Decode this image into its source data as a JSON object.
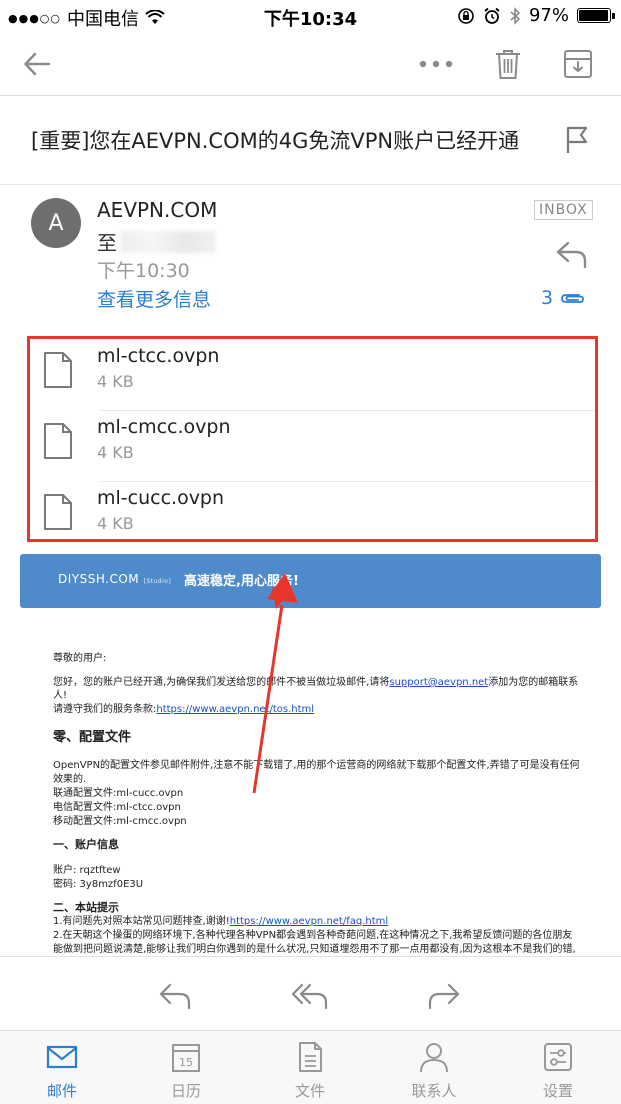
{
  "status_bar": {
    "carrier": "中国电信",
    "time": "下午10:34",
    "battery": "97%",
    "battery_level": 0.97
  },
  "email": {
    "subject": "[重要]您在AEVPN.COM的4G免流VPN账户已经开通",
    "avatar_letter": "A",
    "sender": "AEVPN.COM",
    "to_label": "至",
    "time": "下午10:30",
    "more_info": "查看更多信息",
    "folder_badge": "INBOX",
    "attachment_count": "3"
  },
  "attachments": [
    {
      "name": "ml-ctcc.ovpn",
      "size": "4 KB"
    },
    {
      "name": "ml-cmcc.ovpn",
      "size": "4 KB"
    },
    {
      "name": "ml-cucc.ovpn",
      "size": "4 KB"
    }
  ],
  "content": {
    "banner_logo": "DIYSSH.COM",
    "banner_studio": "[Studio]",
    "banner_slogan": "高速稳定,用心服务!",
    "greeting": "尊敬的用户:",
    "p1_a": "您好，您的账户已经开通,为确保我们发送给您的邮件不被当做垃圾邮件,请将",
    "support_email": "support@aevpn.net",
    "p1_b": "添加为您的邮箱联系",
    "p1_c": "人!",
    "p2_a": "请遵守我们的服务条款:",
    "tos_link": "https://www.aevpn.net/tos.html",
    "section0": "零、配置文件",
    "s0_p1": "OpenVPN的配置文件参见邮件附件,注意不能下载错了,用的那个运营商的网络就下载那个配置文件,弄错了可是没有任何",
    "s0_p2": "效果的.",
    "s0_unicom": "联通配置文件:ml-cucc.ovpn",
    "s0_telecom": "电信配置文件:ml-ctcc.ovpn",
    "s0_mobile": "移动配置文件:ml-cmcc.ovpn",
    "section1": "一、账户信息",
    "account": "账户: rqztftew",
    "password": "密码: 3y8mzf0E3U",
    "section2": "二、本站提示",
    "tip1_a": "1.有问题先对照本站常见问题排查,谢谢!",
    "faq_link": "https://www.aevpn.net/faq.html",
    "tip2_a": "2.在天朝这个操蛋的网络环境下,各种代理各种VPN都会遇到各种奇葩问题,在这种情况之下,我希望反馈问题的各位朋友",
    "tip2_b": "能做到把问题说清楚,能够让我们明白你遇到的是什么状况,只知道埋怨用不了那一点用都没有,因为这根本不是我们的错,"
  },
  "tabs": [
    {
      "label": "邮件",
      "icon": "mail-icon",
      "active": true
    },
    {
      "label": "日历",
      "icon": "calendar-icon",
      "active": false,
      "day": "15"
    },
    {
      "label": "文件",
      "icon": "file-icon",
      "active": false
    },
    {
      "label": "联系人",
      "icon": "contacts-icon",
      "active": false
    },
    {
      "label": "设置",
      "icon": "settings-icon",
      "active": false
    }
  ],
  "colors": {
    "accent": "#2b7fd1",
    "highlight_border": "#e8362a",
    "banner": "#4f8acb",
    "link": "#1a4ec7"
  }
}
